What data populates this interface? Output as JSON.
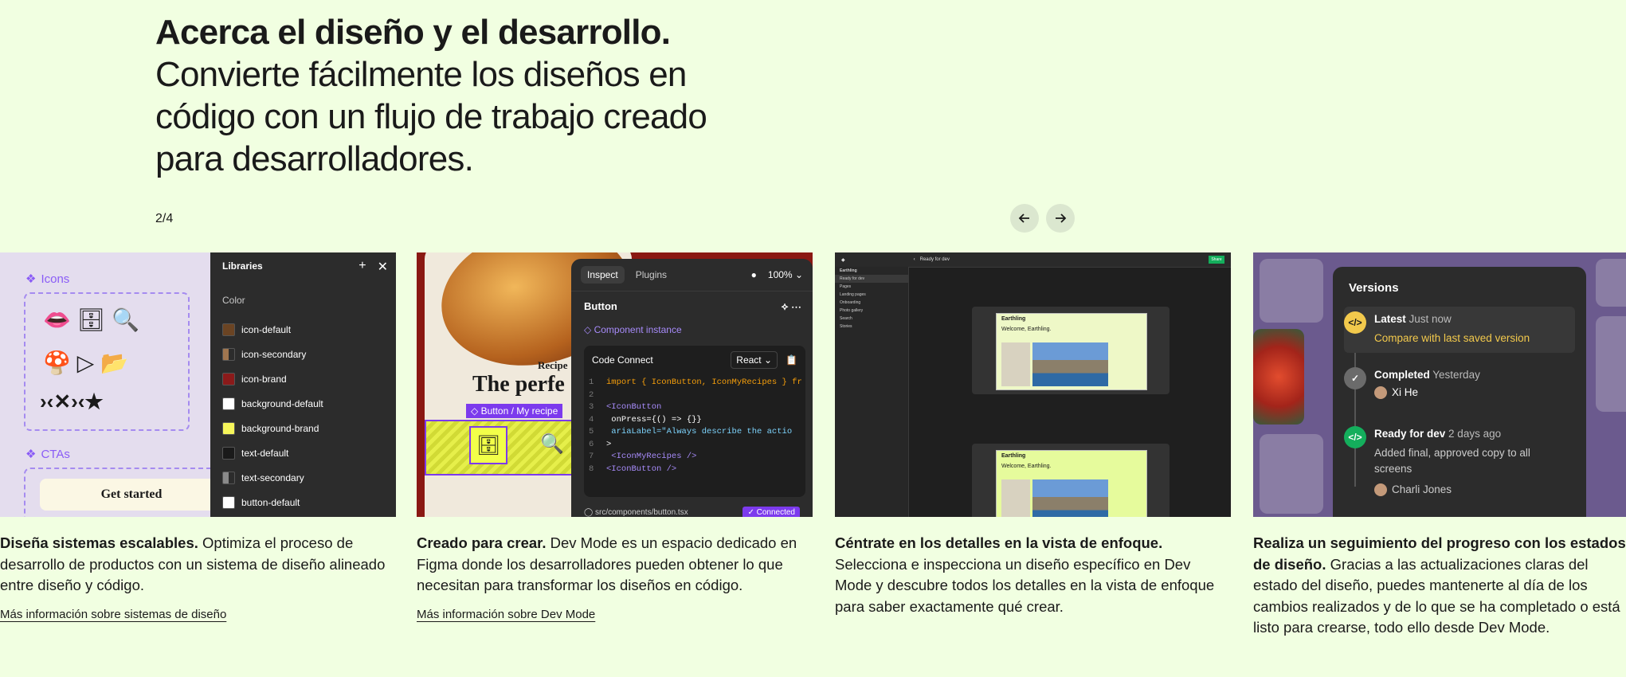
{
  "header": {
    "headline_bold": "Acerca el diseño y el desarrollo.",
    "headline_rest": " Convierte fácilmente los diseños en código con un flujo de trabajo creado para desarrolladores.",
    "counter": "2/4",
    "prev_icon": "arrow-left-icon",
    "next_icon": "arrow-right-icon"
  },
  "cards": [
    {
      "bold": "Diseña sistemas escalables.",
      "text": " Optimiza el proceso de desarrollo de productos con un sistema de diseño alineado entre diseño y código.",
      "link": "Más información sobre sistemas de diseño",
      "mock": {
        "icons_label": "Icons",
        "ctas_label": "CTAs",
        "cta_button": "Get started",
        "libraries_title": "Libraries",
        "color_label": "Color",
        "colors": [
          {
            "name": "icon-default",
            "color": "#6b4423"
          },
          {
            "name": "icon-secondary",
            "color": "#a0764f"
          },
          {
            "name": "icon-brand",
            "color": "#8b1a1a"
          },
          {
            "name": "background-default",
            "color": "#ffffff"
          },
          {
            "name": "background-brand",
            "color": "#f5f55a"
          },
          {
            "name": "text-default",
            "color": "#1a1a1a"
          },
          {
            "name": "text-secondary",
            "color": "#8a8a8a"
          },
          {
            "name": "button-default",
            "color": "#ffffff"
          }
        ]
      }
    },
    {
      "bold": "Creado para crear.",
      "text": " Dev Mode es un espacio dedicado en Figma donde los desarrolladores pueden obtener lo que necesitan para transformar los diseños en código.",
      "link": "Más información sobre Dev Mode",
      "mock": {
        "tab_inspect": "Inspect",
        "tab_plugins": "Plugins",
        "zoom": "100%",
        "component": "Button",
        "instance": "Component instance",
        "code_connect": "Code Connect",
        "framework": "React",
        "code": [
          "import { IconButton, IconMyRecipes } fr",
          "",
          "<IconButton",
          "  onPress={() => {}}",
          "  ariaLabel=\"Always describe the actio",
          ">",
          "  <IconMyRecipes />",
          "<IconButton />"
        ],
        "file": "src/components/button.tsx",
        "status": "Connected",
        "recipe_small": "Recipe",
        "recipe_big": "The perfe",
        "tag": "Button / My recipe"
      }
    },
    {
      "bold": "Céntrate en los detalles en la vista de enfoque.",
      "text": " Selecciona e inspecciona un diseño específico en Dev Mode y descubre todos los detalles en la vista de enfoque para saber exactamente qué crear.",
      "mock": {
        "ready": "Ready for dev",
        "frame_title": "Earthling",
        "welcome": "Welcome, Earthling.",
        "side": [
          "Earthling",
          "Ready for dev",
          "Pages",
          "Landing pages",
          "Onboarding",
          "Photo gallery",
          "Search",
          "Stories"
        ],
        "share": "Share"
      }
    },
    {
      "bold": "Realiza un seguimiento del progreso con los estados de diseño.",
      "text": " Gracias a las actualizaciones claras del estado del diseño, puedes mantenerte al día de los cambios realizados y de lo que se ha completado o está listo para crearse, todo ello desde Dev Mode.",
      "mock": {
        "title": "Versions",
        "items": [
          {
            "label": "Latest",
            "time": "Just now",
            "sub": "Compare with last saved version",
            "color": "#f2c94c"
          },
          {
            "label": "Completed",
            "time": "Yesterday",
            "sub": "Xi He",
            "color": "#6b6b6b"
          },
          {
            "label": "Ready for dev",
            "time": "2 days ago",
            "sub": "Added final, approved copy to all screens",
            "author": "Charli Jones",
            "color": "#14ae5c"
          }
        ]
      }
    }
  ]
}
